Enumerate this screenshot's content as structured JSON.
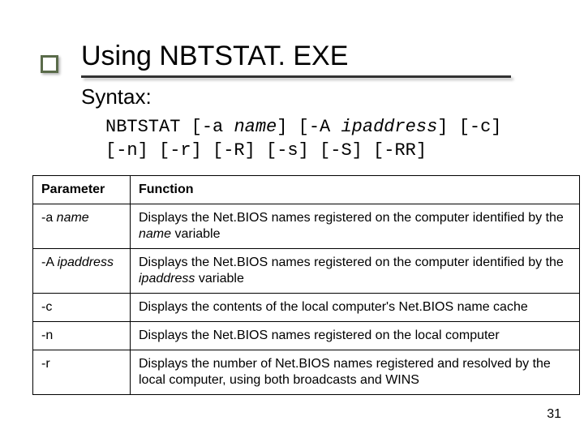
{
  "title": "Using NBTSTAT. EXE",
  "syntax_label": "Syntax:",
  "syntax_line1_a": "NBTSTAT [-a ",
  "syntax_line1_b": "name",
  "syntax_line1_c": "] [-A ",
  "syntax_line1_d": "ipaddress",
  "syntax_line1_e": "]  [-c]",
  "syntax_line2": "[-n] [-r] [-R] [-s] [-S] [-RR]",
  "table": {
    "head_param": "Parameter",
    "head_func": "Function",
    "rows": [
      {
        "param_pre": "-a ",
        "param_ital": "name",
        "param_post": "",
        "func_a": "Displays the Net.BIOS names registered on the computer identified by the ",
        "func_ital": "name",
        "func_b": " variable"
      },
      {
        "param_pre": "-A ",
        "param_ital": "ipaddress",
        "param_post": "",
        "func_a": "Displays the Net.BIOS names registered on the computer identified by the ",
        "func_ital": "ipaddress",
        "func_b": " variable"
      },
      {
        "param_pre": "-c",
        "param_ital": "",
        "param_post": "",
        "func_a": "Displays the contents of the local computer's Net.BIOS name cache",
        "func_ital": "",
        "func_b": ""
      },
      {
        "param_pre": "-n",
        "param_ital": "",
        "param_post": "",
        "func_a": "Displays the Net.BIOS names registered on the local computer",
        "func_ital": "",
        "func_b": ""
      },
      {
        "param_pre": "-r",
        "param_ital": "",
        "param_post": "",
        "func_a": "Displays the number of Net.BIOS names registered and resolved by the local computer, using both broadcasts and WINS",
        "func_ital": "",
        "func_b": ""
      }
    ]
  },
  "page_number": "31"
}
